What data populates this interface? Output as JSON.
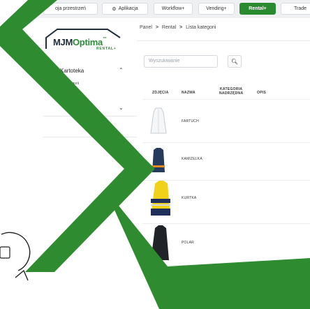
{
  "topbar": {
    "items": [
      {
        "label": "oja przestrzeń",
        "active": false
      },
      {
        "label": "Aplikacja",
        "icon": "gear-icon",
        "active": false
      },
      {
        "label": "Workflow+",
        "active": false
      },
      {
        "label": "Vending+",
        "active": false
      },
      {
        "label": "Rental+",
        "active": true
      },
      {
        "label": "Trade",
        "active": false
      }
    ]
  },
  "logo": {
    "main_a": "MJM",
    "main_b": "Optima",
    "tm": "™",
    "sub": "RENTAL+"
  },
  "sidebar": {
    "section_1": "Kartoteka",
    "item_1": "sta kategorii",
    "item_2": "przedmiotów",
    "section_2": "izacji"
  },
  "breadcrumb": {
    "a": "Panel",
    "b": "Rental",
    "c": "Lista kategorii",
    "sep": ">"
  },
  "search": {
    "placeholder": "Wyszukiwanie"
  },
  "table": {
    "headers": {
      "photo": "ZDJĘCIA",
      "name": "NAZWA",
      "parent_1": "KATEGORIA",
      "parent_2": "NADRZĘDNA",
      "desc": "OPIS"
    },
    "rows": [
      {
        "name": "FARTUCH"
      },
      {
        "name": "KAMIZELKA"
      },
      {
        "name": "KURTKA"
      },
      {
        "name": "POLAR"
      }
    ]
  },
  "colors": {
    "accent": "#2a8a2f",
    "band": "#2e8b2f"
  }
}
